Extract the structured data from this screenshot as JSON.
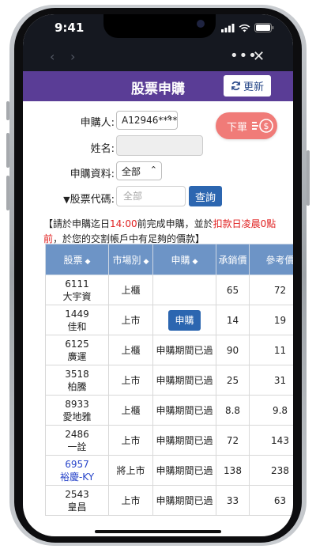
{
  "status_bar": {
    "time": "9:41"
  },
  "browser_nav": {
    "back": "‹",
    "forward": "›",
    "more": "•••",
    "close": "✕"
  },
  "header": {
    "title": "股票申購",
    "refresh_label": "更新"
  },
  "form": {
    "applicant_label": "申購人:",
    "applicant_value": "A12946****",
    "name_label": "姓名:",
    "name_value": "",
    "data_label": "申購資料:",
    "data_value": "全部",
    "code_label": "股票代碼:",
    "code_placeholder": "全部",
    "query_label": "查詢"
  },
  "order_button": {
    "label": "下單"
  },
  "notice": {
    "part1": "【請於申購迄日",
    "time": "14:00",
    "part2": "前完成申購，並於",
    "deduct": "扣款日凌晨0點前",
    "part3": "，於您的交割帳戶中有足夠的價款】"
  },
  "table": {
    "columns": [
      "股票",
      "市場別",
      "申購",
      "承銷價",
      "參考價"
    ],
    "rows": [
      {
        "code": "6111",
        "name": "大宇資",
        "market": "上櫃",
        "status": "",
        "price": "65",
        "ref": "72"
      },
      {
        "code": "1449",
        "name": "佳和",
        "market": "上市",
        "status": "申購",
        "price": "14",
        "ref": "19"
      },
      {
        "code": "6125",
        "name": "廣運",
        "market": "上櫃",
        "status": "申購期間已過",
        "price": "90",
        "ref": "11"
      },
      {
        "code": "3518",
        "name": "柏騰",
        "market": "上市",
        "status": "申購期間已過",
        "price": "25",
        "ref": "31"
      },
      {
        "code": "8933",
        "name": "愛地雅",
        "market": "上櫃",
        "status": "申購期間已過",
        "price": "8.8",
        "ref": "9.8"
      },
      {
        "code": "2486",
        "name": "一詮",
        "market": "上市",
        "status": "申購期間已過",
        "price": "72",
        "ref": "143"
      },
      {
        "code": "6957",
        "name": "裕慶-KY",
        "market": "將上市",
        "status": "申購期間已過",
        "price": "138",
        "ref": "238"
      },
      {
        "code": "2543",
        "name": "皇昌",
        "market": "上市",
        "status": "申購期間已過",
        "price": "33",
        "ref": "63"
      }
    ]
  },
  "colors": {
    "header": "#5a3d96",
    "table_header": "#6d94c6",
    "button": "#2c66b0",
    "order_button": "#f07b78",
    "highlight": "#e02020"
  }
}
